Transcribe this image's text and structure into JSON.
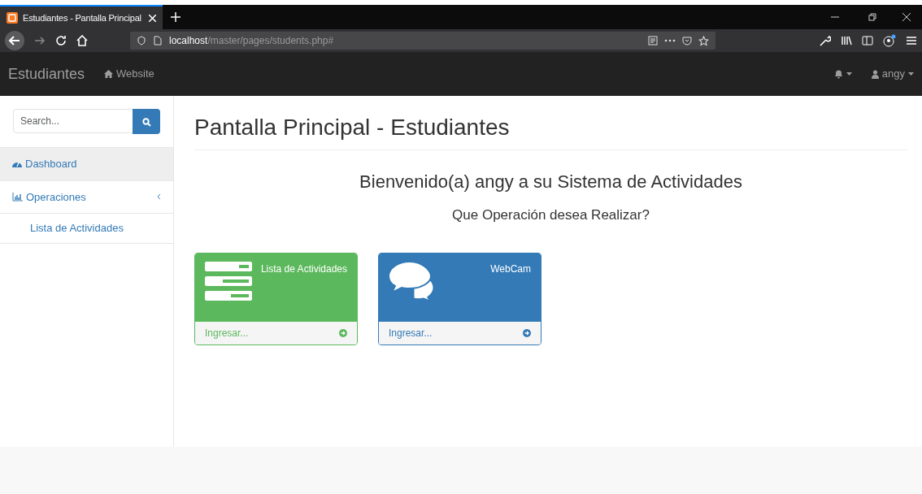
{
  "browser": {
    "tab": {
      "title": "Estudiantes - Pantalla Principal",
      "selected": true
    },
    "url": {
      "host": "localhost",
      "path": "/master/pages/students.php#"
    }
  },
  "navbar": {
    "brand": "Estudiantes",
    "link": "Website",
    "user": "angy"
  },
  "sidebar": {
    "search": {
      "placeholder": "Search..."
    },
    "items": [
      {
        "label": "Dashboard",
        "selected": true
      },
      {
        "label": "Operaciones",
        "selected": false,
        "expanded": true,
        "children": [
          {
            "label": "Lista de Actividades",
            "selected": false
          }
        ]
      }
    ]
  },
  "main": {
    "title": "Pantalla Principal - Estudiantes",
    "welcome": "Bienvenido(a) angy a su Sistema de Actividades",
    "question": "Que Operación desea Realizar?",
    "panels": [
      {
        "kind": "list",
        "title": "Lista de Actividades",
        "link": "Ingresar...",
        "color": "#5cb85c"
      },
      {
        "kind": "chat",
        "title": "WebCam",
        "link": "Ingresar...",
        "color": "#337ab7"
      }
    ]
  }
}
